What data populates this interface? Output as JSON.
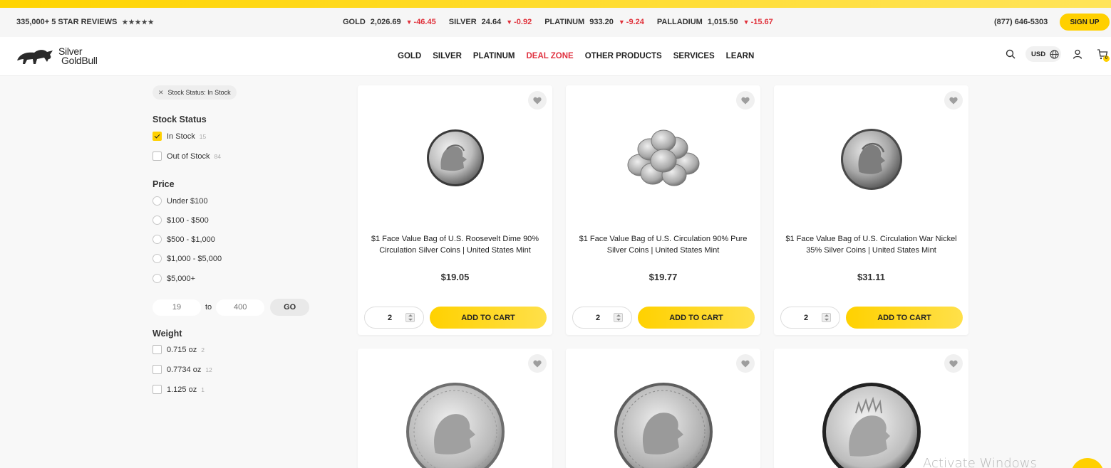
{
  "ticker": {
    "reviews": "335,000+ 5 STAR REVIEWS",
    "stars": "★★★★★",
    "metals": [
      {
        "name": "GOLD",
        "price": "2,026.69",
        "change": "-46.45"
      },
      {
        "name": "SILVER",
        "price": "24.64",
        "change": "-0.92"
      },
      {
        "name": "PLATINUM",
        "price": "933.20",
        "change": "-9.24"
      },
      {
        "name": "PALLADIUM",
        "price": "1,015.50",
        "change": "-15.67"
      }
    ],
    "phone": "(877) 646-5303",
    "signup": "SIGN UP"
  },
  "nav": {
    "logo_line1": "Silver",
    "logo_line2": "GoldBull",
    "items": [
      "GOLD",
      "SILVER",
      "PLATINUM",
      "DEAL ZONE",
      "OTHER PRODUCTS",
      "SERVICES",
      "LEARN"
    ],
    "currency": "USD",
    "cart_count": "0"
  },
  "filters": {
    "active_chip": "Stock Status: In Stock",
    "stock_title": "Stock Status",
    "stock": [
      {
        "label": "In Stock",
        "count": "15",
        "checked": true
      },
      {
        "label": "Out of Stock",
        "count": "84",
        "checked": false
      }
    ],
    "price_title": "Price",
    "price": [
      "Under $100",
      "$100 - $500",
      "$500 - $1,000",
      "$1,000 - $5,000",
      "$5,000+"
    ],
    "range_min": "19",
    "range_to": "to",
    "range_max": "400",
    "go": "GO",
    "weight_title": "Weight",
    "weight": [
      {
        "label": "0.715 oz",
        "count": "2"
      },
      {
        "label": "0.7734 oz",
        "count": "12"
      },
      {
        "label": "1.125 oz",
        "count": "1"
      }
    ]
  },
  "products": [
    {
      "title": "$1 Face Value Bag of U.S. Roosevelt Dime 90% Circulation Silver Coins | United States Mint",
      "price": "$19.05",
      "qty": "2",
      "cta": "ADD TO CART"
    },
    {
      "title": "$1 Face Value Bag of U.S. Circulation 90% Pure Silver Coins | United States Mint",
      "price": "$19.77",
      "qty": "2",
      "cta": "ADD TO CART"
    },
    {
      "title": "$1 Face Value Bag of U.S. Circulation War Nickel 35% Silver Coins | United States Mint",
      "price": "$31.11",
      "qty": "2",
      "cta": "ADD TO CART"
    },
    {
      "title": "",
      "price": "",
      "qty": "",
      "cta": ""
    },
    {
      "title": "",
      "price": "",
      "qty": "",
      "cta": ""
    },
    {
      "title": "",
      "price": "",
      "qty": "",
      "cta": ""
    }
  ],
  "watermark": "Activate Windows",
  "colors": {
    "accent": "#ffd000",
    "down": "#e0303a",
    "deal": "#e03240"
  }
}
